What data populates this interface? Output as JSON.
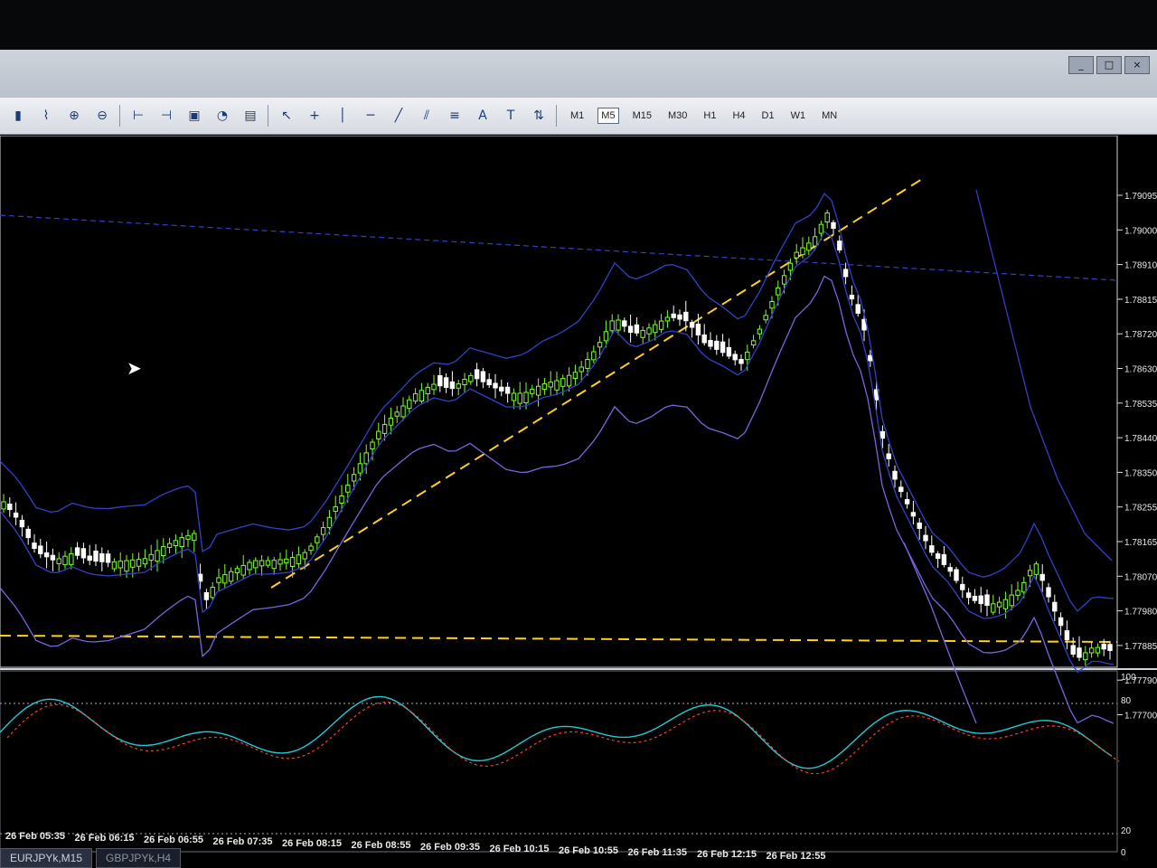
{
  "toolbar": {
    "timeframes": [
      "M1",
      "M5",
      "M15",
      "M30",
      "H1",
      "H4",
      "D1",
      "W1",
      "MN"
    ],
    "active_timeframe": "M5",
    "icons": [
      "chart-bars-icon",
      "chart-line-icon",
      "zoom-in-icon",
      "zoom-out-icon",
      "autoscroll-icon",
      "shift-icon",
      "indicators-icon",
      "periods-icon",
      "templates-icon",
      "cursor-icon",
      "crosshair-icon",
      "vertical-line-icon",
      "horizontal-line-icon",
      "trend-line-icon",
      "equidistant-channel-icon",
      "fibonacci-icon",
      "text-icon",
      "text-label-icon",
      "arrows-icon"
    ]
  },
  "window": {
    "buttons": [
      "_",
      "□",
      "×"
    ],
    "inner_buttons": [
      "-",
      "🗗"
    ]
  },
  "price_axis": [
    "1.79095",
    "1.79000",
    "1.78910",
    "1.78815",
    "1.78720",
    "1.78630",
    "1.78535",
    "1.78440",
    "1.78350",
    "1.78255",
    "1.78165",
    "1.78070",
    "1.77980",
    "1.77885",
    "1.77790",
    "1.77700"
  ],
  "osc_axis": [
    "100",
    "80",
    "20",
    "0"
  ],
  "time_axis": [
    "26 Feb 05:35",
    "26 Feb 06:15",
    "26 Feb 06:55",
    "26 Feb 07:35",
    "26 Feb 08:15",
    "26 Feb 08:55",
    "26 Feb 09:35",
    "26 Feb 10:15",
    "26 Feb 10:55",
    "26 Feb 11:35",
    "26 Feb 12:15",
    "26 Feb 12:55"
  ],
  "tabs": [
    "EURJPYk,M15",
    "GBPJPYk,H4"
  ],
  "colors": {
    "bull": "#7cff2a",
    "bear": "#ffffff",
    "band": "#3340c8",
    "band_outer": "#7b63e0",
    "trend": "#ffd21a",
    "stoch_main": "#24c8d4",
    "stoch_signal": "#ff3a2a"
  }
}
